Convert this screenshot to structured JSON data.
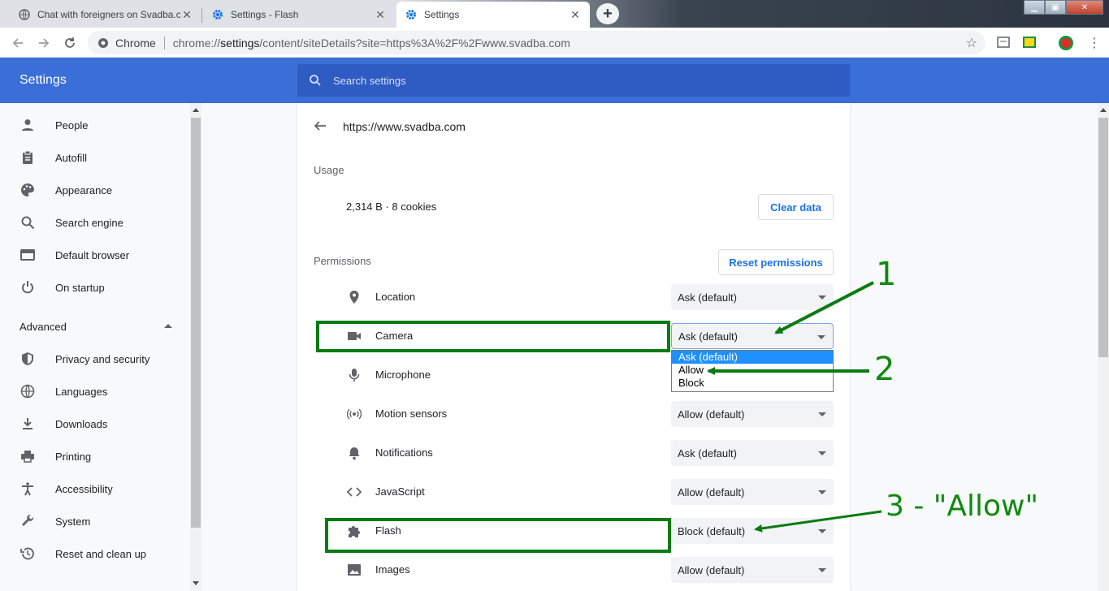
{
  "tabs": [
    {
      "title": "Chat with foreigners on Svadba.c",
      "icon": "globe-icon"
    },
    {
      "title": "Settings - Flash",
      "icon": "gear-icon"
    },
    {
      "title": "Settings",
      "icon": "gear-icon"
    }
  ],
  "toolbar": {
    "chip": "Chrome",
    "url_scheme": "chrome://",
    "url_host": "settings",
    "url_rest": "/content/siteDetails?site=https%3A%2F%2Fwww.svadba.com"
  },
  "header": {
    "title": "Settings",
    "search_placeholder": "Search settings"
  },
  "sidebar": {
    "items": [
      {
        "label": "People",
        "icon": "person-icon"
      },
      {
        "label": "Autofill",
        "icon": "clipboard-icon"
      },
      {
        "label": "Appearance",
        "icon": "palette-icon"
      },
      {
        "label": "Search engine",
        "icon": "search-icon"
      },
      {
        "label": "Default browser",
        "icon": "browser-window-icon"
      },
      {
        "label": "On startup",
        "icon": "power-icon"
      }
    ],
    "advanced_label": "Advanced",
    "advanced_items": [
      {
        "label": "Privacy and security",
        "icon": "shield-icon"
      },
      {
        "label": "Languages",
        "icon": "globe-icon"
      },
      {
        "label": "Downloads",
        "icon": "download-icon"
      },
      {
        "label": "Printing",
        "icon": "printer-icon"
      },
      {
        "label": "Accessibility",
        "icon": "accessibility-icon"
      },
      {
        "label": "System",
        "icon": "wrench-icon"
      },
      {
        "label": "Reset and clean up",
        "icon": "restore-icon"
      }
    ]
  },
  "site": {
    "title": "https://www.svadba.com",
    "usage_label": "Usage",
    "usage_value": "2,314 B · 8 cookies",
    "clear_data_label": "Clear data",
    "permissions_label": "Permissions",
    "reset_permissions_label": "Reset permissions",
    "permissions": [
      {
        "label": "Location",
        "value": "Ask (default)",
        "icon": "location-pin-icon"
      },
      {
        "label": "Camera",
        "value": "Ask (default)",
        "icon": "camera-icon"
      },
      {
        "label": "Microphone",
        "value": "",
        "icon": "microphone-icon"
      },
      {
        "label": "Motion sensors",
        "value": "Allow (default)",
        "icon": "motion-sensors-icon"
      },
      {
        "label": "Notifications",
        "value": "Ask (default)",
        "icon": "bell-icon"
      },
      {
        "label": "JavaScript",
        "value": "Allow (default)",
        "icon": "code-icon"
      },
      {
        "label": "Flash",
        "value": "Block (default)",
        "icon": "puzzle-icon"
      },
      {
        "label": "Images",
        "value": "Allow (default)",
        "icon": "image-icon"
      }
    ],
    "dropdown_options": [
      "Ask (default)",
      "Allow",
      "Block"
    ]
  },
  "annotations": {
    "one": "1",
    "two": "2",
    "three": "3 - \"Allow\"",
    "color": "#0f8a0f"
  }
}
